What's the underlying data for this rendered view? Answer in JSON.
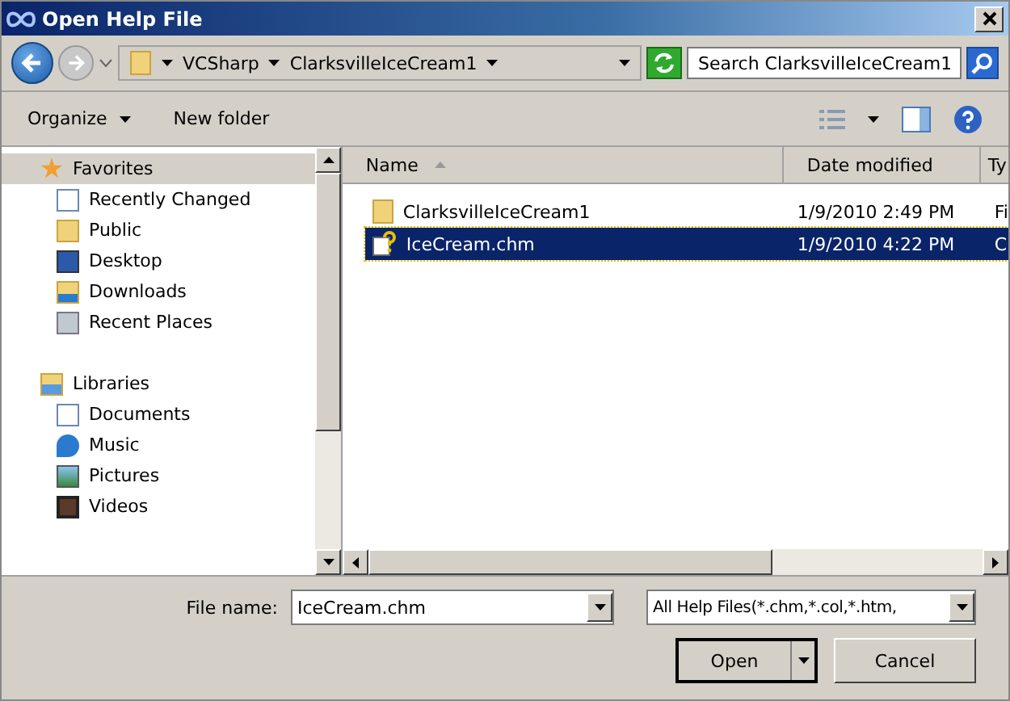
{
  "window": {
    "title": "Open Help File"
  },
  "address_bar": {
    "path": [
      "VCSharp",
      "ClarksvilleIceCream1"
    ]
  },
  "search": {
    "placeholder": "Search ClarksvilleIceCream1"
  },
  "toolbar": {
    "organize": "Organize",
    "new_folder": "New folder"
  },
  "sidebar": {
    "items": [
      {
        "label": "Favorites",
        "kind": "star",
        "selected": true,
        "children": [
          {
            "label": "Recently Changed",
            "kind": "recent",
            "selected": false
          },
          {
            "label": "Public",
            "kind": "folder",
            "selected": false
          },
          {
            "label": "Desktop",
            "kind": "desktop",
            "selected": false
          },
          {
            "label": "Downloads",
            "kind": "downloads",
            "selected": false
          },
          {
            "label": "Recent Places",
            "kind": "places",
            "selected": false
          }
        ]
      },
      {
        "label": "Libraries",
        "kind": "library",
        "selected": false,
        "children": [
          {
            "label": "Documents",
            "kind": "document",
            "selected": false
          },
          {
            "label": "Music",
            "kind": "music",
            "selected": false
          },
          {
            "label": "Pictures",
            "kind": "pictures",
            "selected": false
          },
          {
            "label": "Videos",
            "kind": "videos",
            "selected": false
          }
        ]
      }
    ]
  },
  "table": {
    "columns": [
      "Name",
      "Date modified",
      "Ty"
    ],
    "rows": [
      {
        "kind": "folder",
        "name": "ClarksvilleIceCream1",
        "date": "1/9/2010 2:49 PM",
        "column_3": "Fi",
        "selected": false
      },
      {
        "kind": "help",
        "name": "IceCream.chm",
        "date": "1/9/2010 4:22 PM",
        "column_3": "C",
        "selected": true
      }
    ]
  },
  "file_name": {
    "label": "File name:",
    "value": "IceCream.chm"
  },
  "file_type": {
    "value": "All Help Files(*.chm,*.col,*.htm,"
  },
  "buttons": {
    "open": "Open",
    "cancel": "Cancel"
  }
}
